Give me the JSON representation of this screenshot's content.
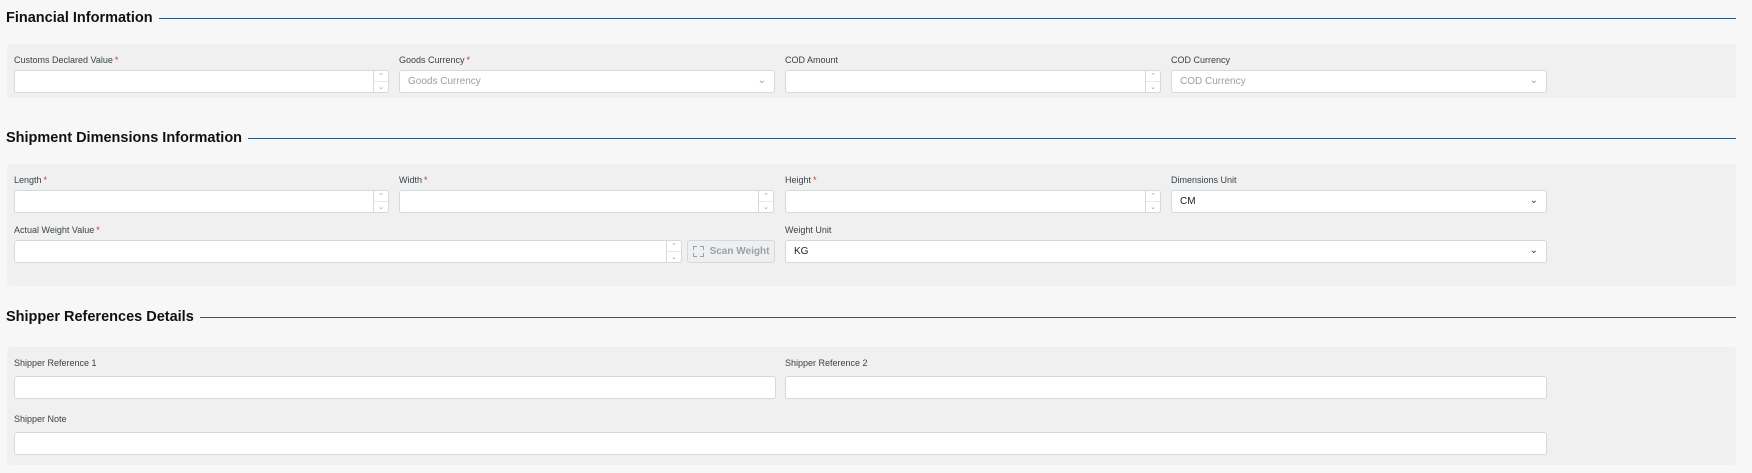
{
  "financial": {
    "title": "Financial Information",
    "customs_declared_value": {
      "label": "Customs Declared Value",
      "required": "*",
      "value": ""
    },
    "goods_currency": {
      "label": "Goods Currency",
      "required": "*",
      "placeholder": "Goods Currency"
    },
    "cod_amount": {
      "label": "COD Amount",
      "value": ""
    },
    "cod_currency": {
      "label": "COD Currency",
      "placeholder": "COD Currency"
    }
  },
  "dimensions": {
    "title": "Shipment Dimensions Information",
    "length": {
      "label": "Length",
      "required": "*",
      "value": ""
    },
    "width": {
      "label": "Width",
      "required": "*",
      "value": ""
    },
    "height": {
      "label": "Height",
      "required": "*",
      "value": ""
    },
    "dimensions_unit": {
      "label": "Dimensions Unit",
      "value": "CM"
    },
    "actual_weight": {
      "label": "Actual Weight Value",
      "required": "*",
      "value": ""
    },
    "scan_weight_label": "Scan Weight",
    "weight_unit": {
      "label": "Weight Unit",
      "value": "KG"
    }
  },
  "references": {
    "title": "Shipper References Details",
    "ref1": {
      "label": "Shipper Reference 1",
      "value": ""
    },
    "ref2": {
      "label": "Shipper Reference 2",
      "value": ""
    },
    "note": {
      "label": "Shipper Note",
      "value": ""
    }
  },
  "icons": {
    "stepper_up": "▲",
    "stepper_down": "▼",
    "chevron": "⌄"
  }
}
